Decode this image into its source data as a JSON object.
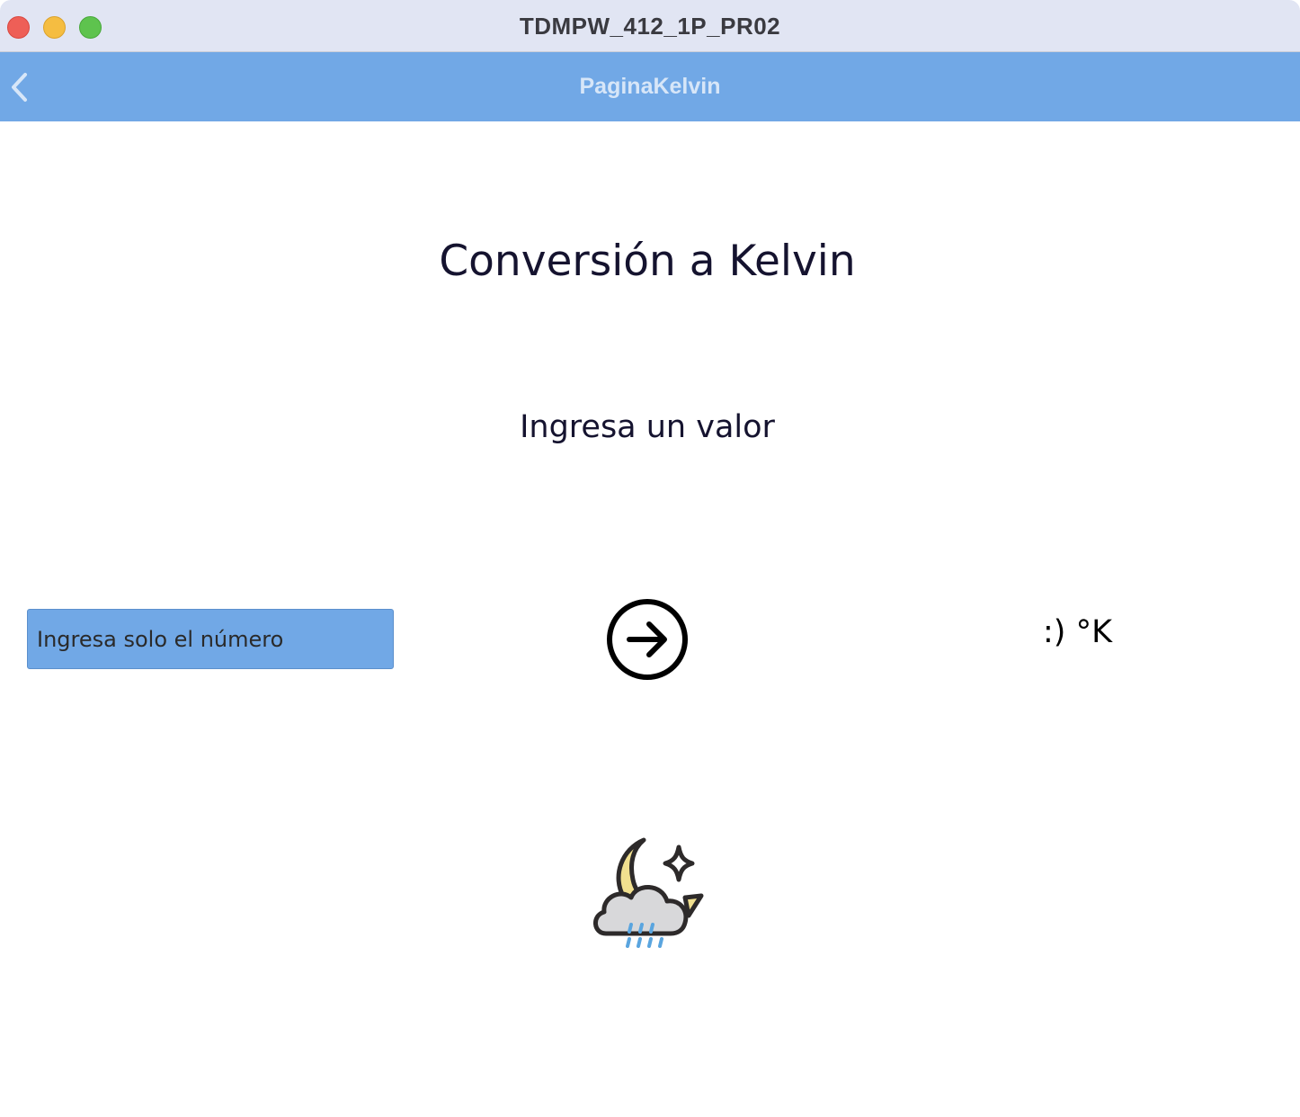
{
  "window": {
    "title": "TDMPW_412_1P_PR02"
  },
  "navbar": {
    "title": "PaginaKelvin",
    "back_icon": "chevron-left-icon"
  },
  "main": {
    "title": "Conversión a Kelvin",
    "prompt": "Ingresa un valor",
    "input": {
      "value": "",
      "placeholder": "Ingresa solo el número"
    },
    "convert_icon": "arrow-right-circle-icon",
    "result": ":) °K",
    "image_icon": "moon-cloud-rain-icon"
  },
  "colors": {
    "accent": "#71a8e6",
    "titlebar": "#e1e5f3",
    "text": "#15132f"
  }
}
